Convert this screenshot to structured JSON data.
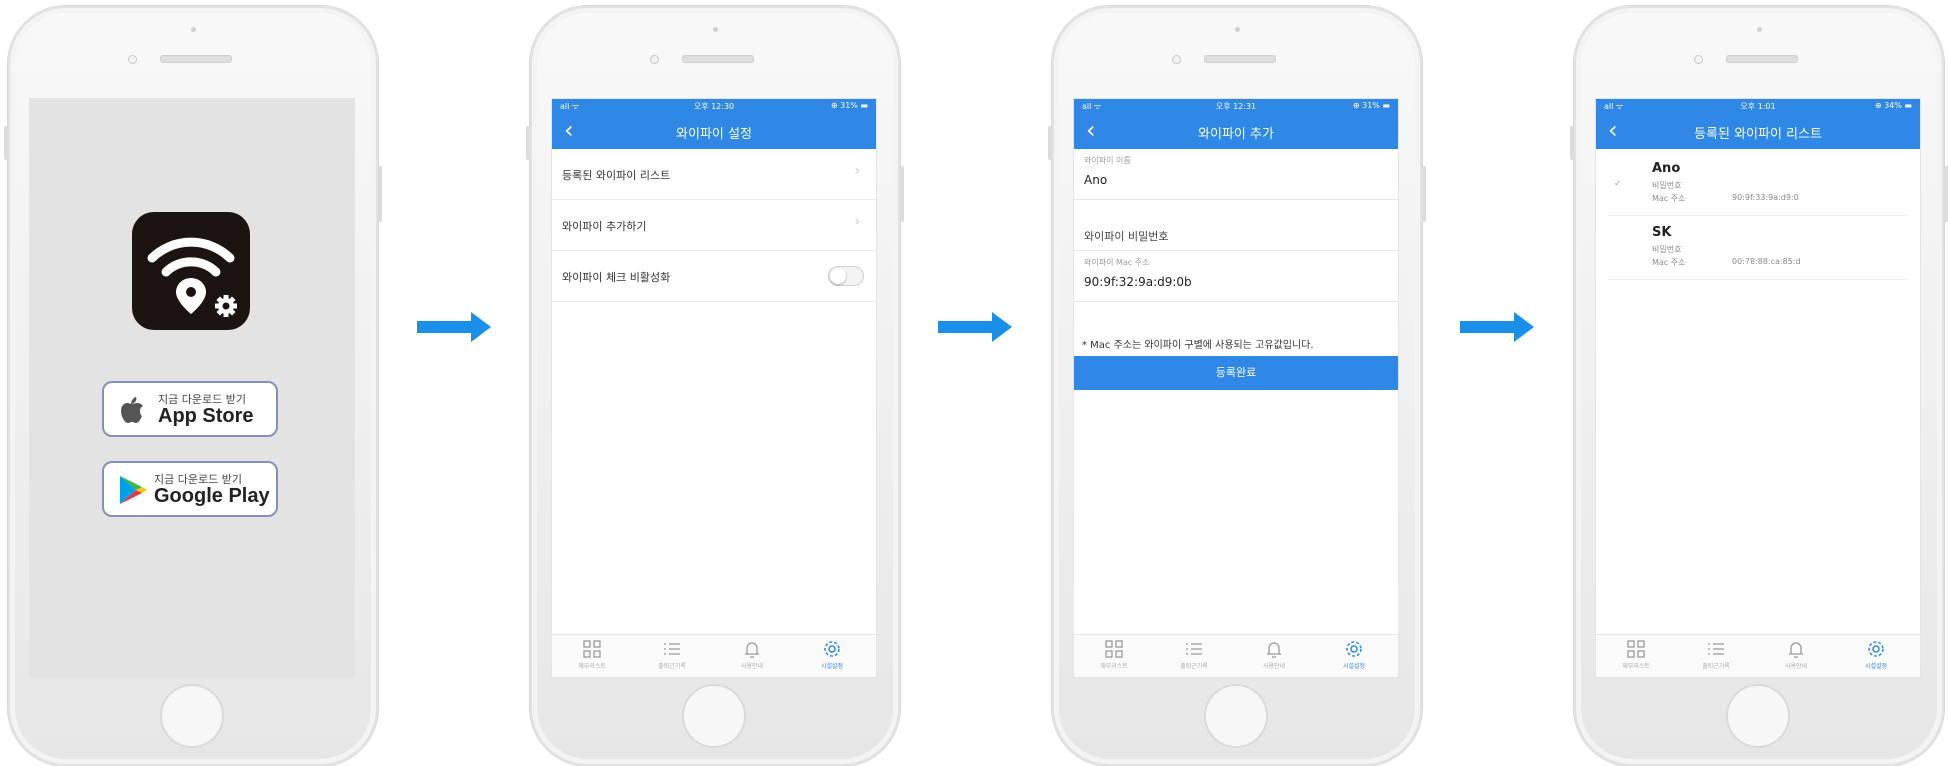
{
  "phone1": {
    "app_store": {
      "small": "지금 다운로드 받기",
      "big": "App Store"
    },
    "google_play": {
      "small": "지금 다운로드 받기",
      "big": "Google Play"
    }
  },
  "status": {
    "signal": "all ᯤ",
    "battery": "⊕ 31% ▬"
  },
  "phone2": {
    "time": "오후 12:30",
    "title": "와이파이 설정",
    "rows": [
      "등록된 와이파이 리스트",
      "와이파이 추가하기",
      "와이파이 체크 비활성화"
    ]
  },
  "phone3": {
    "time": "오후 12:31",
    "title": "와이파이 추가",
    "name_label": "와이파이 이름",
    "name_value": "Ano",
    "password_placeholder": "와이파이 비밀번호",
    "mac_label": "와이파이 Mac 주소",
    "mac_value": "90:9f:32:9a:d9:0b",
    "note": "* Mac 주소는 와이파이 구별에 사용되는 고유값입니다.",
    "submit": "등록완료"
  },
  "phone4": {
    "time": "오후 1:01",
    "battery": "⊕ 34% ▬",
    "title": "등록된 와이파이 리스트",
    "items": [
      {
        "ssid": "Ano",
        "password_label": "비밀번호",
        "mac_label": "Mac 주소",
        "mac": "90:9f:33:9a:d9:0"
      },
      {
        "ssid": "SK",
        "password_label": "비밀번호",
        "mac_label": "Mac 주소",
        "mac": "00:78:88:ca:85:d"
      }
    ]
  },
  "tabs": [
    "재부리스트",
    "출퇴근기록",
    "사용안내",
    "시설설정"
  ],
  "colors": {
    "brand_blue": "#2f87e6",
    "arrow_blue": "#1a8fe8",
    "store_border": "#8194b8"
  }
}
